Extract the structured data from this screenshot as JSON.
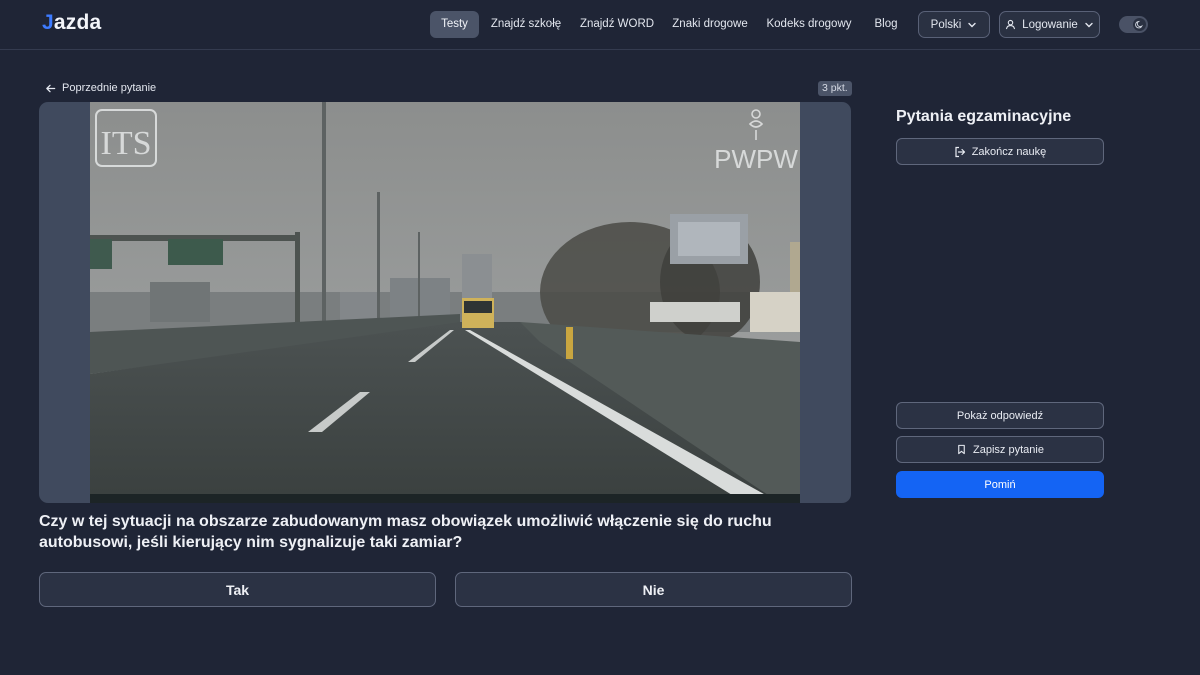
{
  "header": {
    "logo": {
      "first": "J",
      "rest": "azda"
    },
    "nav": [
      {
        "label": "Testy",
        "active": true
      },
      {
        "label": "Znajdź szkołę",
        "active": false
      },
      {
        "label": "Znajdź WORD",
        "active": false
      },
      {
        "label": "Znaki drogowe",
        "active": false
      },
      {
        "label": "Kodeks drogowy",
        "active": false
      },
      {
        "label": "Blog",
        "active": false
      }
    ],
    "language": "Polski",
    "login": "Logowanie",
    "theme_icon": "moon-icon"
  },
  "question": {
    "prev_label": "Poprzednie pytanie",
    "points": "3 pkt.",
    "text": "Czy w tej sytuacji na obszarze zabudowanym masz obowiązek umożliwić włączenie się do ruchu autobusowi, jeśli kierujący nim sygnalizuje taki zamiar?",
    "answers": [
      "Tak",
      "Nie"
    ],
    "media": {
      "watermark_left": "ITS",
      "watermark_right": "PWPW"
    }
  },
  "sidebar": {
    "title": "Pytania egzaminacyjne",
    "end_label": "Zakończ naukę",
    "show_answer_label": "Pokaż odpowiedź",
    "save_label": "Zapisz pytanie",
    "skip_label": "Pomiń"
  },
  "colors": {
    "background": "#1f2536",
    "accent": "#1464f4",
    "logo_accent": "#3d7bff",
    "active_nav": "#4b5468"
  }
}
